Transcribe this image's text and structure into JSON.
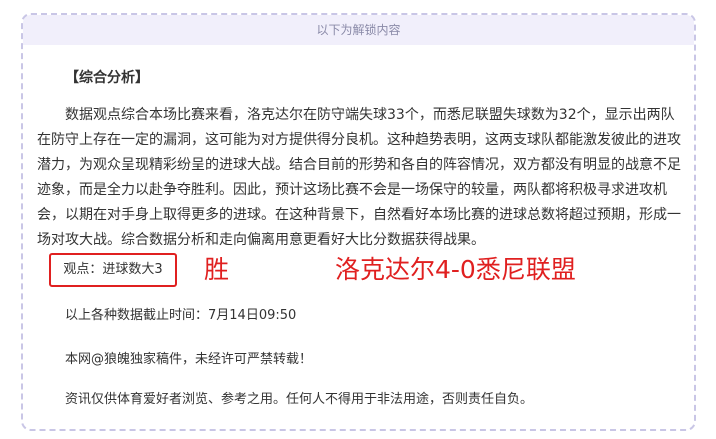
{
  "header": {
    "notice": "以下为解锁内容"
  },
  "analysis": {
    "title": "【综合分析】",
    "body": "数据观点综合本场比赛来看，洛克达尔在防守端失球33个，而悉尼联盟失球数为32个，显示出两队在防守上存在一定的漏洞，这可能为对方提供得分良机。这种趋势表明，这两支球队都能激发彼此的进攻潜力，为观众呈现精彩纷呈的进球大战。结合目前的形势和各自的阵容情况，双方都没有明显的战意不足迹象，而是全力以赴争夺胜利。因此，预计这场比赛不会是一场保守的较量，两队都将积极寻求进攻机会，以期在对手身上取得更多的进球。在这种背景下，自然看好本场比赛的进球总数将超过预期，形成一场对攻大战。综合数据分析和走向偏离用意更看好大比分数据获得战果。"
  },
  "opinion": {
    "label": "观点：进球数大3",
    "result": "胜",
    "score_prediction": "洛克达尔4-0悉尼联盟"
  },
  "footer": {
    "deadline": "以上各种数据截止时间：7月14日09:50",
    "copyright": "本网@狼魄独家稿件，未经许可严禁转载！",
    "disclaimer": "资讯仅供体育爱好者浏览、参考之用。任何人不得用于非法用途，否则责任自负。"
  },
  "colors": {
    "accent_red": "#e02020",
    "border_dash": "#c9c6e6",
    "header_bg": "#f1effb"
  }
}
